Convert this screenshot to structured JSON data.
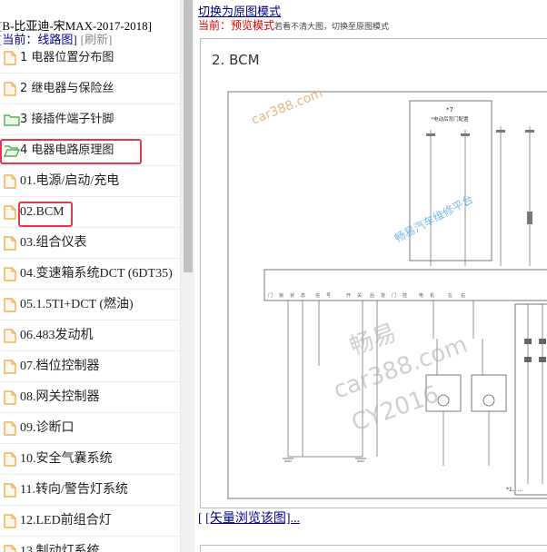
{
  "left": {
    "title": "[B-比亚迪-宋MAX-2017-2018]",
    "current": "[当前：线路图]",
    "refresh": "[刷新]",
    "items": [
      {
        "label": "1 电器位置分布图",
        "icon": "file-icon"
      },
      {
        "label": "2 继电器与保险丝",
        "icon": "file-icon"
      },
      {
        "label": "3 接插件端子针脚",
        "icon": "folder-icon"
      },
      {
        "label": "4 电器电路原理图",
        "icon": "folder-open-icon"
      },
      {
        "label": "01.电源/启动/充电",
        "icon": "file-icon"
      },
      {
        "label": "02.BCM",
        "icon": "file-icon"
      },
      {
        "label": "03.组合仪表",
        "icon": "file-icon"
      },
      {
        "label": "04.变速箱系统DCT (6DT35)",
        "icon": "file-icon"
      },
      {
        "label": "05.1.5TI+DCT (燃油)",
        "icon": "file-icon"
      },
      {
        "label": "06.483发动机",
        "icon": "file-icon"
      },
      {
        "label": "07.档位控制器",
        "icon": "file-icon"
      },
      {
        "label": "08.网关控制器",
        "icon": "file-icon"
      },
      {
        "label": "09.诊断口",
        "icon": "file-icon"
      },
      {
        "label": "10.安全气囊系统",
        "icon": "file-icon"
      },
      {
        "label": "11.转向/警告灯系统",
        "icon": "file-icon"
      },
      {
        "label": "12.LED前组合灯",
        "icon": "file-icon"
      },
      {
        "label": "13.制动灯系统",
        "icon": "file-icon"
      }
    ]
  },
  "right": {
    "switch_link": "切换为原图模式",
    "mode_prefix": "当前：预览模式",
    "mode_hint": "若看不清大图，切换至原图模式",
    "diagram_title": "2. BCM",
    "vector_link_open": "[ ",
    "vector_link_text": "[矢量浏览该图]...",
    "watermarks": [
      "car388.com",
      "畅易汽车维修平台",
      "畅易",
      "car388.com",
      "CY2016"
    ],
    "diagram_labels": {
      "top_box": "*7",
      "top_box_sub": "*电动后背门配置",
      "bottom_left": "*1、...",
      "bottom_right": "*1、*"
    }
  },
  "colors": {
    "link": "#00008b",
    "highlight": "#e23a4a",
    "mode_red": "#dd0000",
    "icon_orange": "#e8a33d",
    "icon_green": "#3aa13a"
  }
}
